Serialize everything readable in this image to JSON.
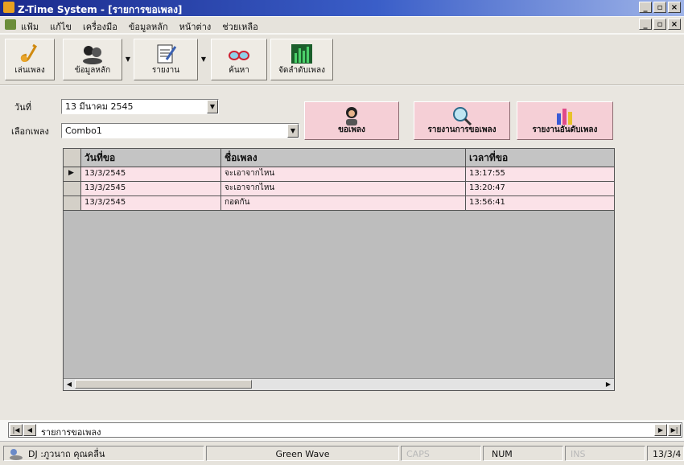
{
  "window": {
    "title": "Z-Time System - [รายการขอเพลง]",
    "controls": [
      "_",
      "▫",
      "×"
    ],
    "mdi_controls": [
      "_",
      "▫",
      "×"
    ]
  },
  "menu": {
    "items": [
      "แฟ้ม",
      "แก้ไข",
      "เครื่องมือ",
      "ข้อมูลหลัก",
      "หน้าต่าง",
      "ช่วยเหลือ"
    ]
  },
  "toolbar": {
    "buttons": [
      {
        "label": "เล่นเพลง",
        "icon": "saxophone-icon"
      },
      {
        "label": "ข้อมูลหลัก",
        "icon": "people-icon"
      },
      {
        "label": "รายงาน",
        "icon": "report-icon"
      },
      {
        "label": "ค้นหา",
        "icon": "glasses-icon"
      },
      {
        "label": "จัดลำดับเพลง",
        "icon": "ranking-chart-icon"
      }
    ]
  },
  "form": {
    "date_label": "วันที่",
    "date_value": "13   มีนาคม   2545",
    "song_label": "เลือกเพลง",
    "song_value": "Combo1",
    "request_button": "ขอเพลง",
    "request_report_button": "รายงานการขอเพลง",
    "rank_report_button": "รายงานอันดับเพลง"
  },
  "grid": {
    "columns": [
      "วันที่ขอ",
      "ชื่อเพลง",
      "เวลาที่ขอ"
    ],
    "rows": [
      [
        "13/3/2545",
        "จะเอาจากไหน",
        "13:17:55"
      ],
      [
        "13/3/2545",
        "จะเอาจากไหน",
        "13:20:47"
      ],
      [
        "13/3/2545",
        "กอดกัน",
        "13:56:41"
      ]
    ]
  },
  "navigator": {
    "caption": "รายการขอเพลง"
  },
  "status": {
    "user": "DJ :ภูวนาถ คุณคลื่น",
    "station": "Green Wave",
    "caps": "CAPS",
    "num": "NUM",
    "ins": "INS",
    "date": "13/3/4"
  },
  "colors": {
    "title_bar": "#1a2a8c",
    "grid_row": "#fbe2e8",
    "action_button": "#f5cfd6"
  }
}
